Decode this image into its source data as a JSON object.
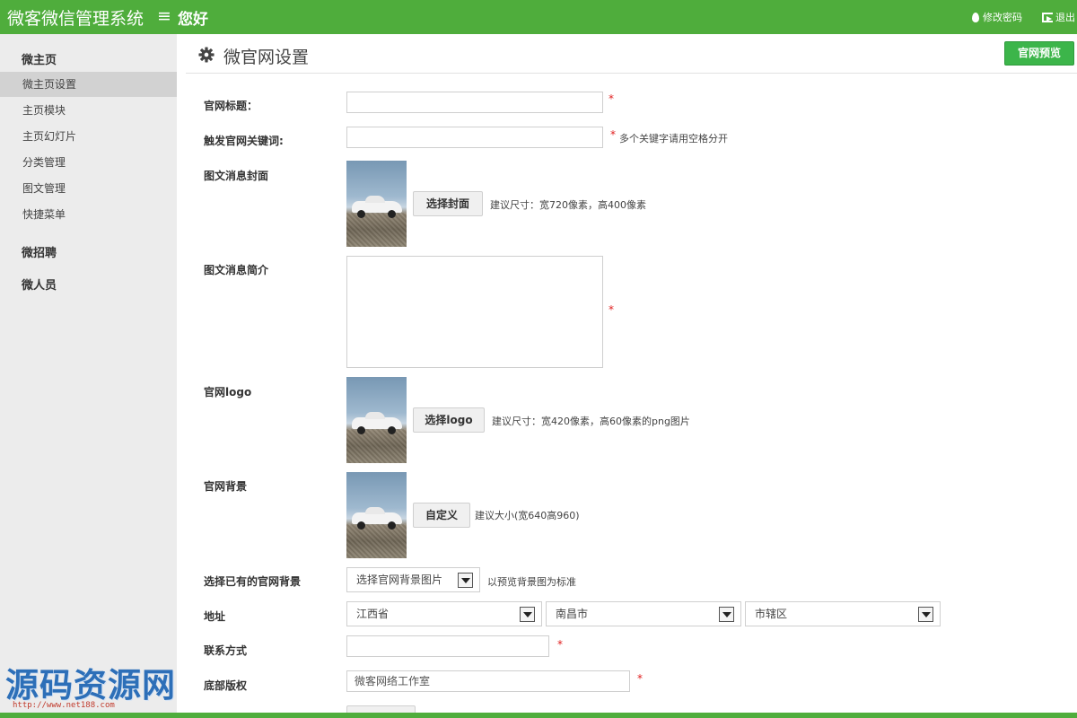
{
  "header": {
    "app_title": "微客微信管理系统",
    "menu_icon": "≡",
    "greeting": "您好",
    "change_password": "修改密码",
    "logout": "退出"
  },
  "sidebar": {
    "group1": "微主页",
    "items": [
      "微主页设置",
      "主页模块",
      "主页幻灯片",
      "分类管理",
      "图文管理",
      "快捷菜单"
    ],
    "group2": "微招聘",
    "group3": "微人员"
  },
  "page": {
    "title": "微官网设置",
    "preview_button": "官网预览"
  },
  "form": {
    "site_title_label": "官网标题：",
    "site_title_value": "",
    "keyword_label": "触发官网关键词:",
    "keyword_value": "",
    "keyword_hint": "多个关键字请用空格分开",
    "cover_label": "图文消息封面",
    "cover_button": "选择封面",
    "cover_hint": "建议尺寸：宽720像素，高400像素",
    "intro_label": "图文消息简介",
    "logo_label": "官网logo",
    "logo_button": "选择logo",
    "logo_hint": "建议尺寸：宽420像素，高60像素的png图片",
    "bg_label": "官网背景",
    "bg_button": "自定义",
    "bg_hint": "建议大小(宽640高960)",
    "existing_bg_label": "选择已有的官网背景",
    "existing_bg_select": "选择官网背景图片",
    "existing_bg_hint": "以预览背景图为标准",
    "address_label": "地址",
    "province": "江西省",
    "city": "南昌市",
    "district": "市辖区",
    "contact_label": "联系方式",
    "contact_value": "",
    "copyright_label": "底部版权",
    "copyright_value": "微客网络工作室",
    "required_mark": "*"
  },
  "watermark": {
    "text": "源码资源网",
    "url": "http://www.net188.com"
  },
  "colors": {
    "brand_green": "#4fad3c",
    "button_green": "#3cb54a",
    "required_red": "#e02020"
  }
}
